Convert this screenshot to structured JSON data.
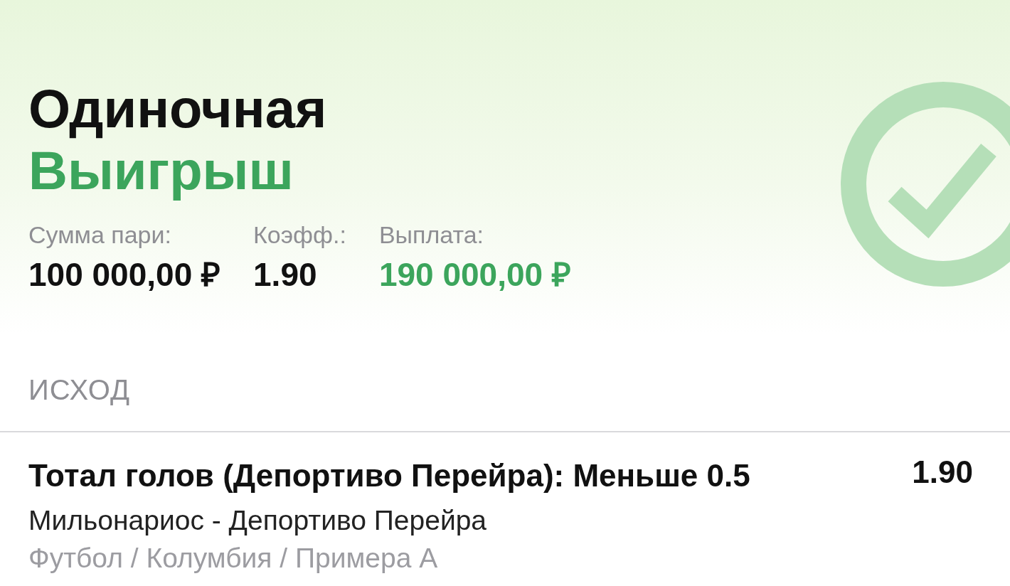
{
  "summary": {
    "bet_type": "Одиночная",
    "result": {
      "label": "Выигрыш",
      "won": true
    },
    "stats": [
      {
        "label": "Сумма пари:",
        "value": "100 000,00 ₽",
        "kind": "plain"
      },
      {
        "label": "Коэфф.:",
        "value": "1.90",
        "kind": "plain"
      },
      {
        "label": "Выплата:",
        "value": "190 000,00 ₽",
        "kind": "payout"
      }
    ]
  },
  "outcome_section": {
    "title": "ИСХОД",
    "outcomes": [
      {
        "selection": "Тотал голов (Депортиво Перейра): Меньше 0.5",
        "odds": "1.90",
        "match": "Мильонариос - Депортиво Перейра",
        "category": "Футбол / Колумбия / Примера А"
      }
    ]
  }
}
